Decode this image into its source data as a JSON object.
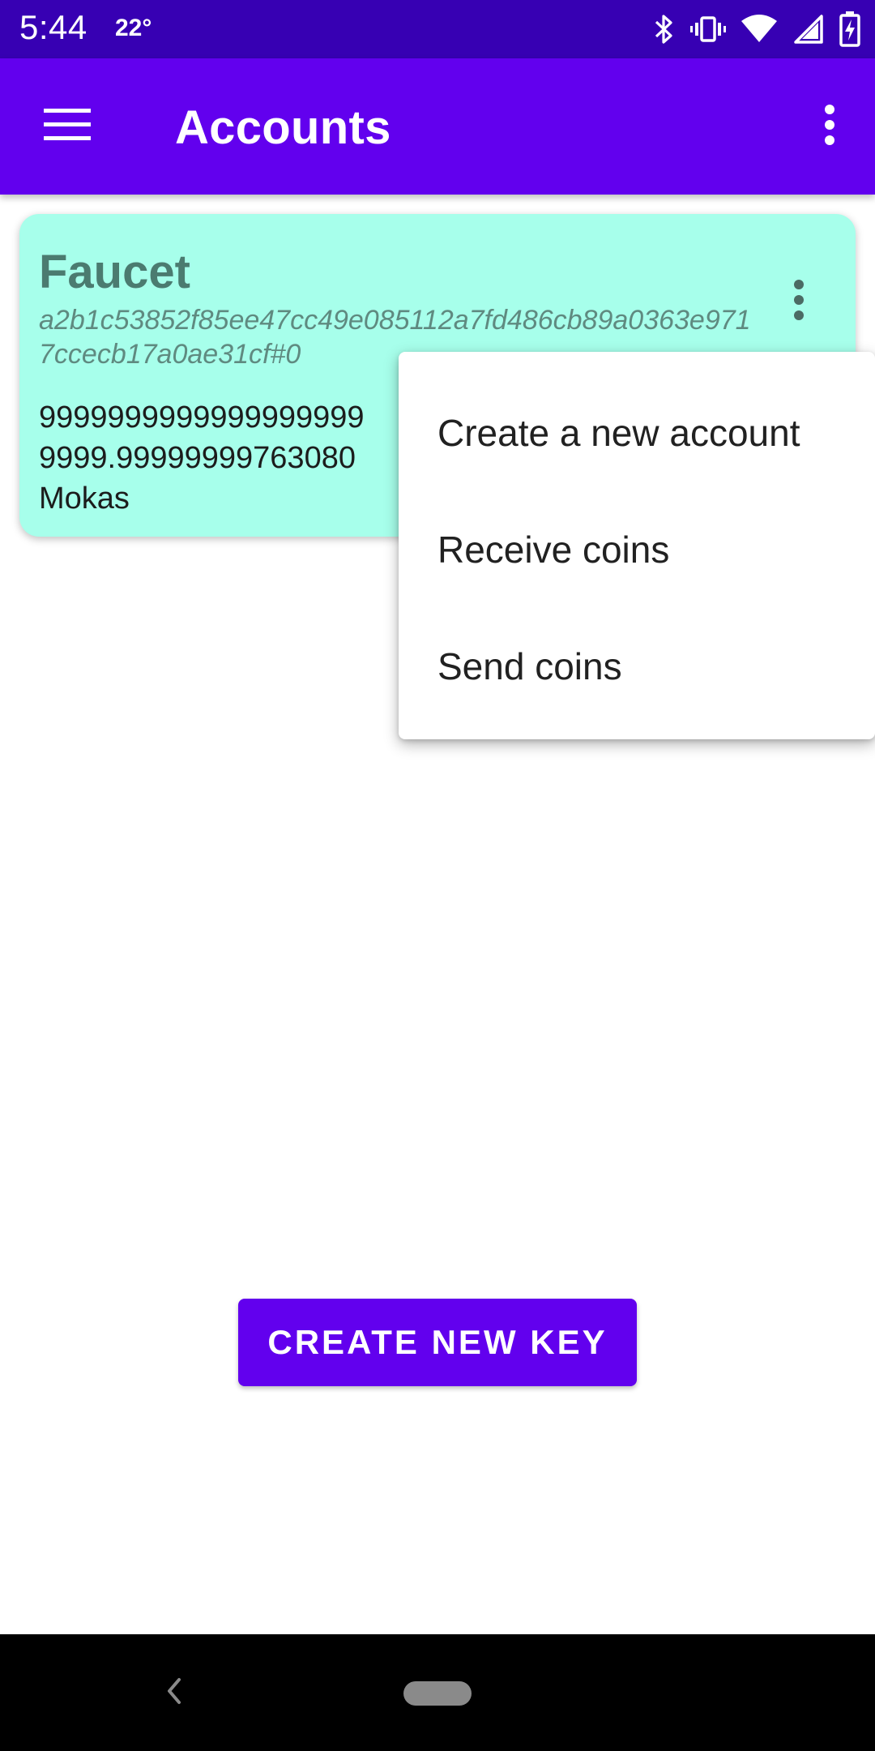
{
  "status_bar": {
    "time": "5:44",
    "temperature": "22°",
    "icons": [
      "bluetooth-icon",
      "vibrate-icon",
      "wifi-icon",
      "signal-icon",
      "battery-charging-icon"
    ]
  },
  "app_bar": {
    "title": "Accounts",
    "menu_icon": "hamburger-menu-icon",
    "overflow_icon": "more-vert-icon"
  },
  "account_card": {
    "name": "Faucet",
    "key": "a2b1c53852f85ee47cc49e085112a7fd486cb89a0363e9717ccecb17a0ae31cf#0",
    "balance_line1": "9999999999999999999",
    "balance_line2": "9999.99999999763080",
    "balance_unit": "Mokas",
    "more_icon": "more-vert-icon"
  },
  "popup_menu": {
    "items": [
      {
        "label": "Create a new account"
      },
      {
        "label": "Receive coins"
      },
      {
        "label": "Send coins"
      }
    ]
  },
  "main": {
    "create_key_label": "CREATE NEW KEY"
  },
  "colors": {
    "status_bar": "#3700b3",
    "primary": "#6200ee",
    "card_background": "#a7ffeb",
    "nav_bar": "#000000"
  }
}
